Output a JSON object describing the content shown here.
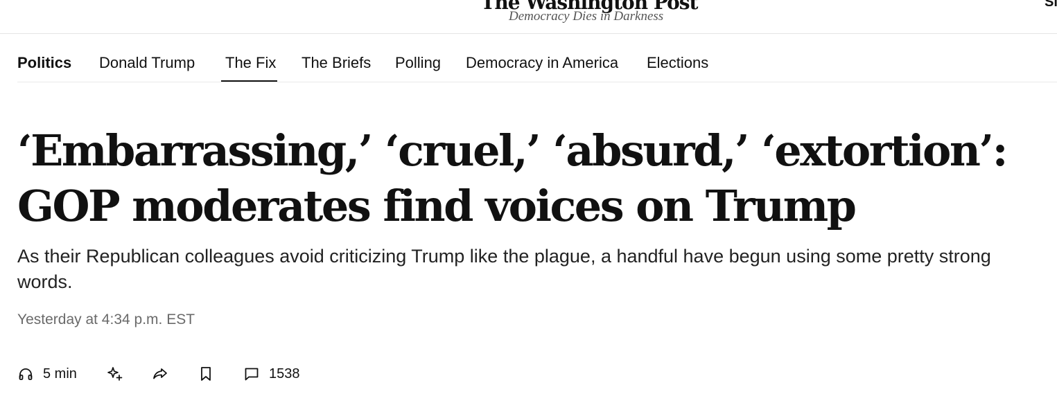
{
  "masthead": {
    "logo_text": "The Washington Post",
    "tagline": "Democracy Dies in Darkness",
    "corner_button": "Sign in"
  },
  "subnav": {
    "section": "Politics",
    "items": [
      {
        "label": "Donald Trump"
      },
      {
        "label": "The Fix",
        "active": true
      },
      {
        "label": "The Briefs"
      },
      {
        "label": "Polling"
      },
      {
        "label": "Democracy in America"
      },
      {
        "label": "Elections"
      }
    ]
  },
  "article": {
    "headline": "‘Embarrassing,’ ‘cruel,’ ‘absurd,’ ‘extortion’: GOP moderates find voices on Trump",
    "dek": "As their Republican colleagues avoid criticizing Trump like the plague, a handful have begun using some pretty strong words.",
    "timestamp": "Yesterday at 4:34 p.m. EST"
  },
  "actions": {
    "listen_icon": "headphones-icon",
    "listen_label": "5 min",
    "summary_icon": "sparkle-icon",
    "share_icon": "share-arrow-icon",
    "save_icon": "bookmark-icon",
    "comments_icon": "comment-bubble-icon",
    "comments_count": "1538"
  }
}
